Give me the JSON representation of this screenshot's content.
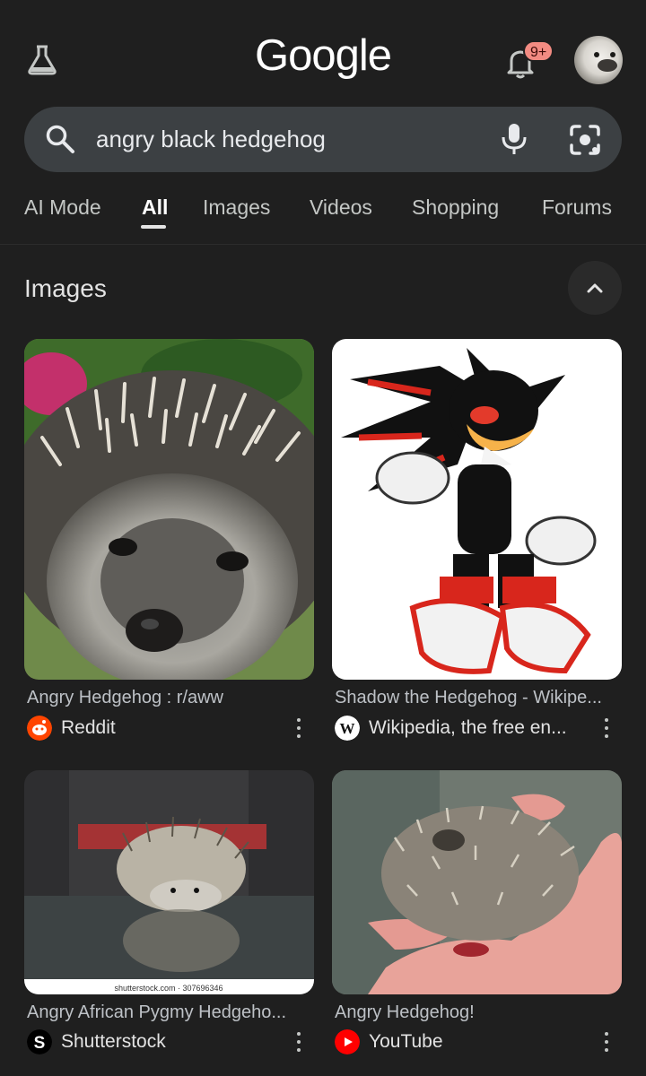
{
  "header": {
    "logo_text": "Google",
    "notification_badge": "9+",
    "labs_icon": "flask-icon",
    "bell_icon": "bell-icon"
  },
  "search": {
    "query": "angry black hedgehog",
    "search_icon": "search-icon",
    "mic_icon": "mic-icon",
    "lens_icon": "camera-lens-icon"
  },
  "tabs": [
    {
      "label": "AI Mode"
    },
    {
      "label": "All",
      "active": true
    },
    {
      "label": "Images"
    },
    {
      "label": "Videos"
    },
    {
      "label": "Shopping"
    },
    {
      "label": "Forums"
    }
  ],
  "images_section": {
    "title": "Images",
    "collapse_icon": "chevron-up-icon",
    "results": [
      {
        "title": "Angry Hedgehog : r/aww",
        "source": "Reddit",
        "source_icon": "reddit-icon"
      },
      {
        "title": "Shadow the Hedgehog - Wikipe...",
        "source": "Wikipedia, the free en...",
        "source_icon": "wikipedia-icon"
      },
      {
        "title": "Angry African Pygmy Hedgeho...",
        "source": "Shutterstock",
        "source_icon": "shutterstock-icon",
        "watermark": "shutterstock.com · 307696346"
      },
      {
        "title": "Angry Hedgehog!",
        "source": "YouTube",
        "source_icon": "youtube-icon"
      }
    ]
  },
  "colors": {
    "background": "#1f1f1f",
    "search_bar": "#3c4043",
    "badge": "#f28b82",
    "youtube_red": "#ff0000",
    "reddit_orange": "#ff4500"
  }
}
